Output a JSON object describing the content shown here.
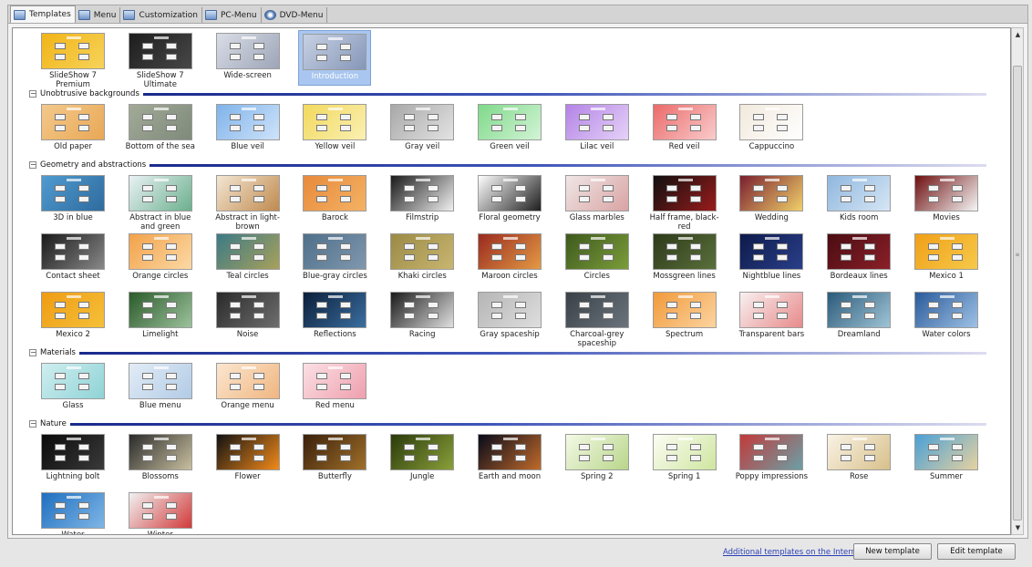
{
  "tabs": [
    {
      "label": "Templates",
      "icon": "templates-icon",
      "active": true
    },
    {
      "label": "Menu",
      "icon": "menu-icon"
    },
    {
      "label": "Customization",
      "icon": "customization-icon"
    },
    {
      "label": "PC-Menu",
      "icon": "pc-menu-icon"
    },
    {
      "label": "DVD-Menu",
      "icon": "dvd-disc-icon"
    }
  ],
  "top_templates": [
    {
      "label": "SlideShow 7 Premium",
      "bg": "#f2b418",
      "bg2": "#f6d35a"
    },
    {
      "label": "SlideShow 7 Ultimate",
      "bg": "#1d1d1d",
      "bg2": "#484848"
    },
    {
      "label": "Wide-screen",
      "bg": "#d9dde6",
      "bg2": "#9da5b8"
    },
    {
      "label": "Introduction",
      "bg": "#c7d1e3",
      "bg2": "#8596b8",
      "selected": true
    }
  ],
  "groups": [
    {
      "label": "Unobtrusive backgrounds",
      "items": [
        {
          "label": "Old paper",
          "bg": "#f3c98b",
          "bg2": "#e9a856"
        },
        {
          "label": "Bottom of the sea",
          "bg": "#a2aa97",
          "bg2": "#7f8a7b"
        },
        {
          "label": "Blue veil",
          "bg": "#7fb3ea",
          "bg2": "#cfe3fa"
        },
        {
          "label": "Yellow veil",
          "bg": "#f2d95d",
          "bg2": "#faf0b3"
        },
        {
          "label": "Gray veil",
          "bg": "#a8a8a8",
          "bg2": "#e3e3e3"
        },
        {
          "label": "Green veil",
          "bg": "#7fd98a",
          "bg2": "#d3f4d6"
        },
        {
          "label": "Lilac veil",
          "bg": "#b483e6",
          "bg2": "#e5d2f8"
        },
        {
          "label": "Red veil",
          "bg": "#ec6a6a",
          "bg2": "#f9cccc"
        },
        {
          "label": "Cappuccino",
          "bg": "#f1e9dc",
          "bg2": "#ffffff"
        }
      ]
    },
    {
      "label": "Geometry and abstractions",
      "items": [
        {
          "label": "3D in blue",
          "bg": "#4f9bd1",
          "bg2": "#2f6b9e"
        },
        {
          "label": "Abstract in blue and green",
          "bg": "#e9f1f5",
          "bg2": "#6bb08c"
        },
        {
          "label": "Abstract in light-brown",
          "bg": "#f3e6d3",
          "bg2": "#c08a4e"
        },
        {
          "label": "Barock",
          "bg": "#e88a3c",
          "bg2": "#f4b264"
        },
        {
          "label": "Filmstrip",
          "bg": "#1a1a1a",
          "bg2": "#f0f0f0"
        },
        {
          "label": "Floral geometry",
          "bg": "#ffffff",
          "bg2": "#1f1f1f"
        },
        {
          "label": "Glass marbles",
          "bg": "#f0e6e6",
          "bg2": "#d9a3a3"
        },
        {
          "label": "Half frame, black-red",
          "bg": "#0f0f0f",
          "bg2": "#9a1c1c"
        },
        {
          "label": "Wedding",
          "bg": "#7a1f2e",
          "bg2": "#f0d06a"
        },
        {
          "label": "Kids room",
          "bg": "#8fb7de",
          "bg2": "#d6e6f5"
        },
        {
          "label": "Movies",
          "bg": "#6e0f0f",
          "bg2": "#f6f6f6"
        },
        {
          "label": "Contact sheet",
          "bg": "#1a1a1a",
          "bg2": "#888888"
        },
        {
          "label": "Orange circles",
          "bg": "#f2a24a",
          "bg2": "#fcd9a5"
        },
        {
          "label": "Teal circles",
          "bg": "#3c7a86",
          "bg2": "#a7a15a"
        },
        {
          "label": "Blue-gray circles",
          "bg": "#4f6f8a",
          "bg2": "#7f98ae"
        },
        {
          "label": "Khaki circles",
          "bg": "#9a8a45",
          "bg2": "#c9b670"
        },
        {
          "label": "Maroon circles",
          "bg": "#9a2a1f",
          "bg2": "#e39a45"
        },
        {
          "label": "Circles",
          "bg": "#3e5a1d",
          "bg2": "#7b9c3a"
        },
        {
          "label": "Mossgreen lines",
          "bg": "#2e3a1a",
          "bg2": "#59703a"
        },
        {
          "label": "Nightblue lines",
          "bg": "#0d1a4a",
          "bg2": "#2a3f8a"
        },
        {
          "label": "Bordeaux lines",
          "bg": "#4a0d12",
          "bg2": "#8a1f28"
        },
        {
          "label": "Mexico 1",
          "bg": "#f0a018",
          "bg2": "#f6c94a"
        },
        {
          "label": "Mexico 2",
          "bg": "#ef9c14",
          "bg2": "#f5c039"
        },
        {
          "label": "Limelight",
          "bg": "#2a5a2a",
          "bg2": "#9cc29c"
        },
        {
          "label": "Noise",
          "bg": "#2a2a2a",
          "bg2": "#6e6e6e"
        },
        {
          "label": "Reflections",
          "bg": "#0b1e3a",
          "bg2": "#3a6ea0"
        },
        {
          "label": "Racing",
          "bg": "#1a1a1a",
          "bg2": "#e0e0e0"
        },
        {
          "label": "Gray spaceship",
          "bg": "#b5b5b5",
          "bg2": "#dedede"
        },
        {
          "label": "Charcoal-grey spaceship",
          "bg": "#3a4148",
          "bg2": "#6a737c"
        },
        {
          "label": "Spectrum",
          "bg": "#f19a3a",
          "bg2": "#fcd4a0"
        },
        {
          "label": "Transparent bars",
          "bg": "#f8f0f0",
          "bg2": "#e88a8a"
        },
        {
          "label": "Dreamland",
          "bg": "#2a5a7a",
          "bg2": "#9fc4d6"
        },
        {
          "label": "Water colors",
          "bg": "#2a5a9a",
          "bg2": "#9ec2e6"
        }
      ]
    },
    {
      "label": "Materials",
      "items": [
        {
          "label": "Glass",
          "bg": "#cfeef0",
          "bg2": "#8fd3d6"
        },
        {
          "label": "Blue menu",
          "bg": "#e2ecf6",
          "bg2": "#b2cbe6"
        },
        {
          "label": "Orange menu",
          "bg": "#fbe6d0",
          "bg2": "#f0b680"
        },
        {
          "label": "Red menu",
          "bg": "#fbe0e4",
          "bg2": "#ef9fae"
        }
      ]
    },
    {
      "label": "Nature",
      "items": [
        {
          "label": "Lightning bolt",
          "bg": "#0a0a0a",
          "bg2": "#3a3a3a"
        },
        {
          "label": "Blossoms",
          "bg": "#2a2a2a",
          "bg2": "#c9c0a0"
        },
        {
          "label": "Flower",
          "bg": "#121212",
          "bg2": "#f28a1a"
        },
        {
          "label": "Butterfly",
          "bg": "#3a1f0a",
          "bg2": "#a0702a"
        },
        {
          "label": "Jungle",
          "bg": "#2a3a0a",
          "bg2": "#8aa03a"
        },
        {
          "label": "Earth and moon",
          "bg": "#070a1a",
          "bg2": "#c06a2a"
        },
        {
          "label": "Spring 2",
          "bg": "#f4f9e6",
          "bg2": "#b8d68a"
        },
        {
          "label": "Spring 1",
          "bg": "#fbfdf3",
          "bg2": "#cfe5a0"
        },
        {
          "label": "Poppy impressions",
          "bg": "#c23a3a",
          "bg2": "#6aa0a6"
        },
        {
          "label": "Rose",
          "bg": "#f9f3e6",
          "bg2": "#d8c08a"
        },
        {
          "label": "Summer",
          "bg": "#4aa0d6",
          "bg2": "#e6d2a0"
        },
        {
          "label": "Water",
          "bg": "#1f6fc0",
          "bg2": "#7fb6e6"
        },
        {
          "label": "Winter",
          "bg": "#f1f1f1",
          "bg2": "#d23a3a"
        }
      ]
    }
  ],
  "footer": {
    "link": "Additional templates on the Internet",
    "new_button": "New template",
    "edit_button": "Edit template"
  }
}
